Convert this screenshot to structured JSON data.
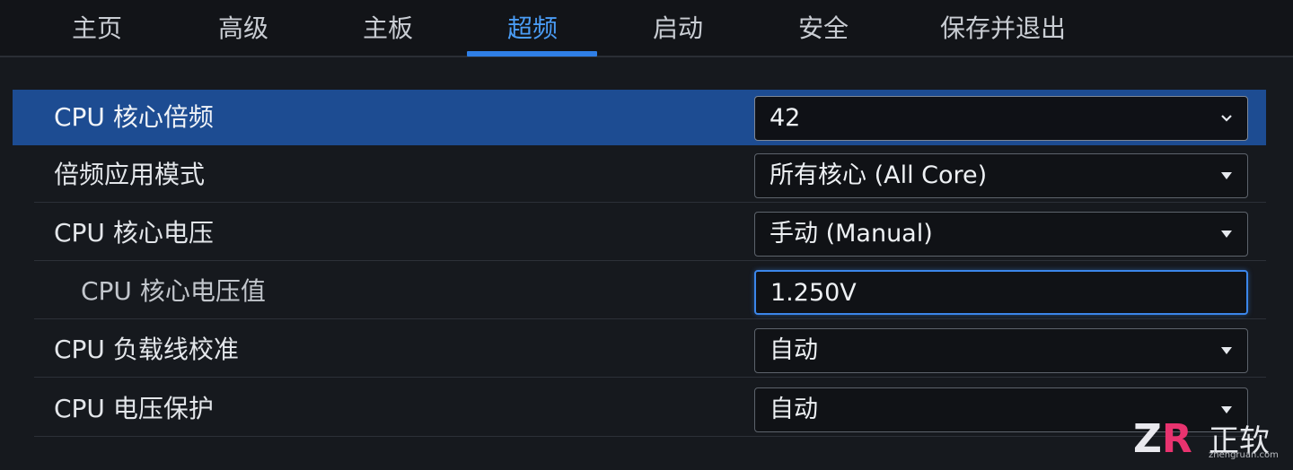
{
  "tabs": [
    {
      "label": "主页",
      "active": false
    },
    {
      "label": "高级",
      "active": false
    },
    {
      "label": "主板",
      "active": false
    },
    {
      "label": "超频",
      "active": true
    },
    {
      "label": "启动",
      "active": false
    },
    {
      "label": "安全",
      "active": false
    },
    {
      "label": "保存并退出",
      "active": false
    }
  ],
  "settings": [
    {
      "label": "CPU 核心倍频",
      "value": "42",
      "control": "dropdown",
      "icon": "chevron-down-icon"
    },
    {
      "label": "倍频应用模式",
      "value": "所有核心 (All Core)",
      "control": "dropdown",
      "icon": "triangle-down-icon"
    },
    {
      "label": "CPU 核心电压",
      "value": "手动 (Manual)",
      "control": "dropdown",
      "icon": "triangle-down-icon"
    },
    {
      "label": "CPU 核心电压值",
      "value": "1.250V",
      "control": "text-input"
    },
    {
      "label": "CPU 负载线校准",
      "value": "自动",
      "control": "dropdown",
      "icon": "triangle-down-icon"
    },
    {
      "label": "CPU 电压保护",
      "value": "自动",
      "control": "dropdown",
      "icon": "triangle-down-icon"
    }
  ],
  "watermark": {
    "brand": "正软",
    "logo_text": "ZR",
    "url": "zhengruan.com"
  },
  "colors": {
    "background": "#16191e",
    "selected_row": "#1d4c92",
    "active_tab": "#4a9cf5",
    "focus_border": "#3b86ea",
    "logo_z": "#e9e9ee",
    "logo_r": "#e8336f"
  }
}
